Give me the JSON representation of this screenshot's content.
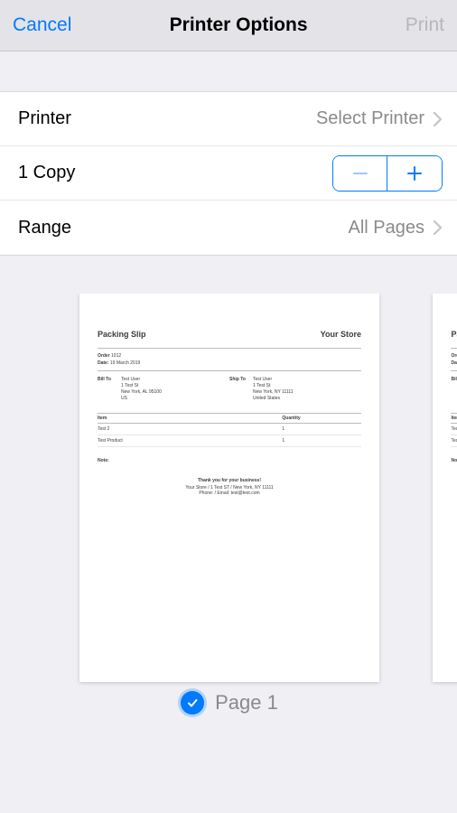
{
  "nav": {
    "cancel": "Cancel",
    "title": "Printer Options",
    "print": "Print"
  },
  "rows": {
    "printer": {
      "label": "Printer",
      "value": "Select Printer"
    },
    "copies": {
      "label": "1 Copy"
    },
    "range": {
      "label": "Range",
      "value": "All Pages"
    }
  },
  "preview": {
    "page_label": "Page 1",
    "document": {
      "title": "Packing Slip",
      "store": "Your Store",
      "order_label": "Order",
      "order_value": "1012",
      "date_label": "Date:",
      "date_value": "19 March 2019",
      "bill_to_label": "Bill To",
      "bill_to": "Test User\n1 Test St\nNew York, AL 95100\nUS",
      "ship_to_label": "Ship To",
      "ship_to": "Test User\n1 Test St\nNew York, NY 11111\nUnited States",
      "item_header": "Item",
      "qty_header": "Quantity",
      "items": [
        {
          "name": "Test 2",
          "qty": "1"
        },
        {
          "name": "Test Product",
          "qty": "1"
        }
      ],
      "note_label": "Note:",
      "footer_thanks": "Thank you for your business!",
      "footer_address": "Your Store / 1 Test ST / New York, NY 11111",
      "footer_contact": "Phone: / Email: test@test.com"
    }
  }
}
